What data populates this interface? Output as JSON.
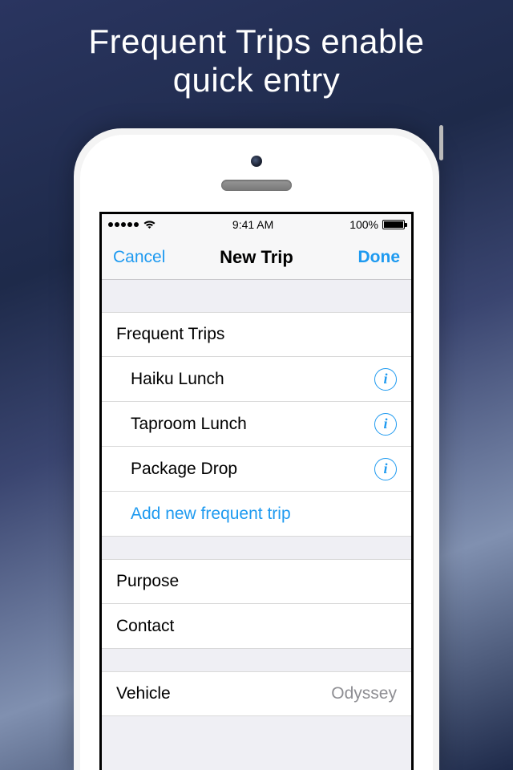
{
  "promo": {
    "line1": "Frequent Trips enable",
    "line2": "quick entry"
  },
  "status_bar": {
    "time": "9:41 AM",
    "battery_pct": "100%"
  },
  "nav": {
    "cancel": "Cancel",
    "title": "New Trip",
    "done": "Done"
  },
  "sections": {
    "frequent": {
      "header": "Frequent Trips",
      "items": [
        {
          "label": "Haiku Lunch"
        },
        {
          "label": "Taproom Lunch"
        },
        {
          "label": "Package Drop"
        }
      ],
      "add_label": "Add new frequent trip"
    },
    "details": {
      "purpose_label": "Purpose",
      "contact_label": "Contact"
    },
    "vehicle": {
      "label": "Vehicle",
      "value": "Odyssey"
    }
  },
  "icons": {
    "info_glyph": "i"
  }
}
